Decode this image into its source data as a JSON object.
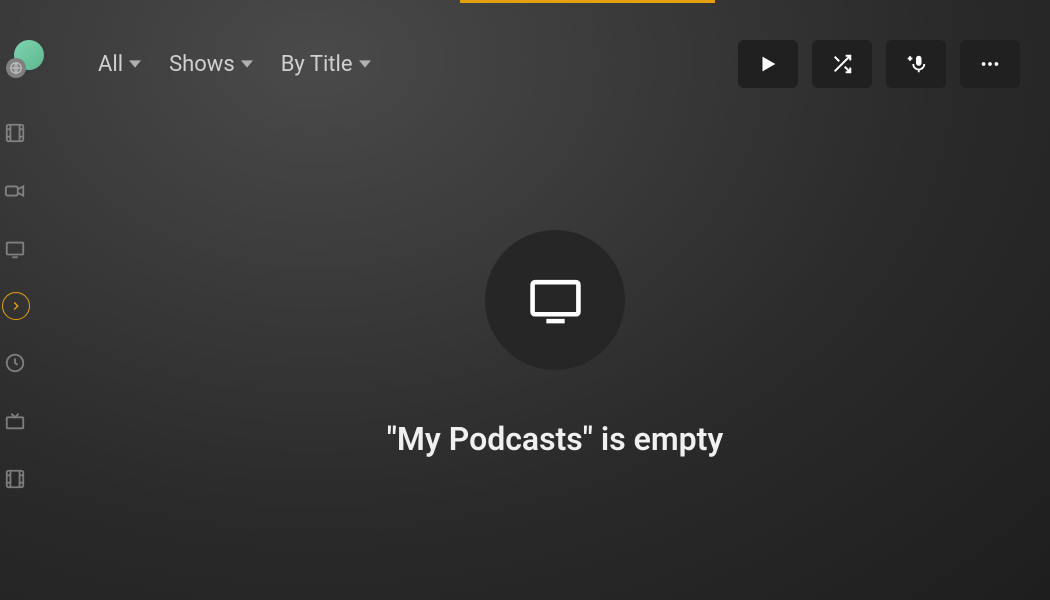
{
  "filters": {
    "all": "All",
    "shows": "Shows",
    "sort": "By Title"
  },
  "empty_state": {
    "message": "\"My Podcasts\" is empty"
  }
}
